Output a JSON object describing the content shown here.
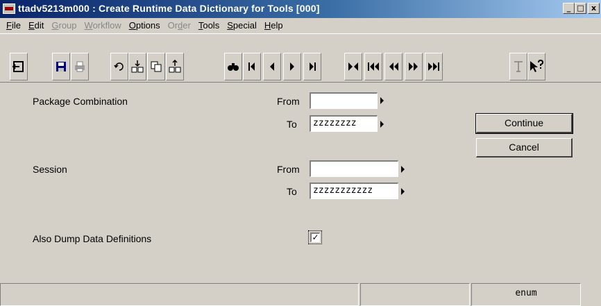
{
  "window": {
    "title": "ttadv5213m000 : Create Runtime Data Dictionary for Tools [000]",
    "minimize": "_",
    "maximize": "□",
    "close": "x"
  },
  "menu": [
    {
      "label": "File",
      "u": "F",
      "rest": "ile",
      "enabled": true
    },
    {
      "label": "Edit",
      "u": "E",
      "rest": "dit",
      "enabled": true
    },
    {
      "label": "Group",
      "u": "G",
      "rest": "roup",
      "enabled": false
    },
    {
      "label": "Workflow",
      "u": "W",
      "rest": "orkflow",
      "enabled": false
    },
    {
      "label": "Options",
      "u": "O",
      "rest": "ptions",
      "enabled": true
    },
    {
      "label": "Order",
      "u": "d",
      "pre": "Or",
      "rest": "er",
      "enabled": false
    },
    {
      "label": "Tools",
      "u": "T",
      "rest": "ools",
      "enabled": true
    },
    {
      "label": "Special",
      "u": "S",
      "rest": "pecial",
      "enabled": true
    },
    {
      "label": "Help",
      "u": "H",
      "rest": "elp",
      "enabled": true
    }
  ],
  "toolbar": {
    "icons": [
      "exit-icon",
      "save-icon",
      "print-icon",
      "undo-icon",
      "insert-icon",
      "copy-icon",
      "delete-icon",
      "find-icon",
      "first-icon",
      "previous-icon",
      "next-icon",
      "last-icon",
      "first-set-icon",
      "first-page-icon",
      "previous-page-icon",
      "next-page-icon",
      "last-page-icon",
      "text-icon",
      "help-pointer-icon"
    ]
  },
  "form": {
    "package_combination": {
      "label": "Package Combination",
      "from_label": "From",
      "from_value": "",
      "to_label": "To",
      "to_value": "zzzzzzzz"
    },
    "session": {
      "label": "Session",
      "from_label": "From",
      "from_value": "",
      "to_label": "To",
      "to_value": "zzzzzzzzzzz"
    },
    "dump_definitions": {
      "label": "Also Dump Data Definitions",
      "checked": true,
      "mark": "✓"
    },
    "continue_label": "Continue",
    "cancel_label": "Cancel"
  },
  "status": {
    "pane1": "",
    "pane2": "",
    "pane3": "enum"
  }
}
